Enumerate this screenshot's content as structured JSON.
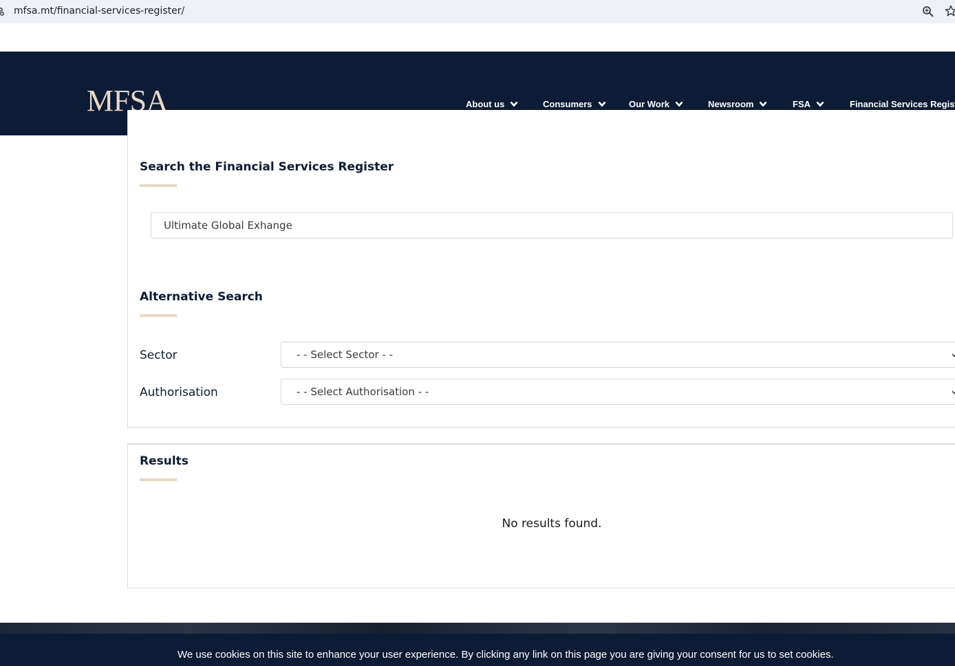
{
  "browser": {
    "url": "mfsa.mt/financial-services-register/"
  },
  "header": {
    "logo": "MFSA",
    "nav": [
      {
        "label": "About us"
      },
      {
        "label": "Consumers"
      },
      {
        "label": "Our Work"
      },
      {
        "label": "Newsroom"
      },
      {
        "label": "FSA"
      },
      {
        "label": "Financial Services Register"
      }
    ]
  },
  "search": {
    "heading": "Search the Financial Services Register",
    "input_value": "Ultimate Global Exhange"
  },
  "alternative": {
    "heading": "Alternative Search",
    "sector_label": "Sector",
    "sector_selected": "- - Select Sector - -",
    "authorisation_label": "Authorisation",
    "authorisation_selected": "- - Select Authorisation - -"
  },
  "results": {
    "heading": "Results",
    "message": "No results found."
  },
  "cookie": {
    "text": "We use cookies on this site to enhance your user experience. By clicking any link on this page you are giving your consent for us to set cookies."
  },
  "colors": {
    "navy": "#0c1c36",
    "accent": "#ead7c4"
  },
  "icons": {
    "site_info": "site-info-icon",
    "zoom": "zoom-icon",
    "bookmark": "star-icon",
    "dropdown": "chevron-down-icon"
  }
}
